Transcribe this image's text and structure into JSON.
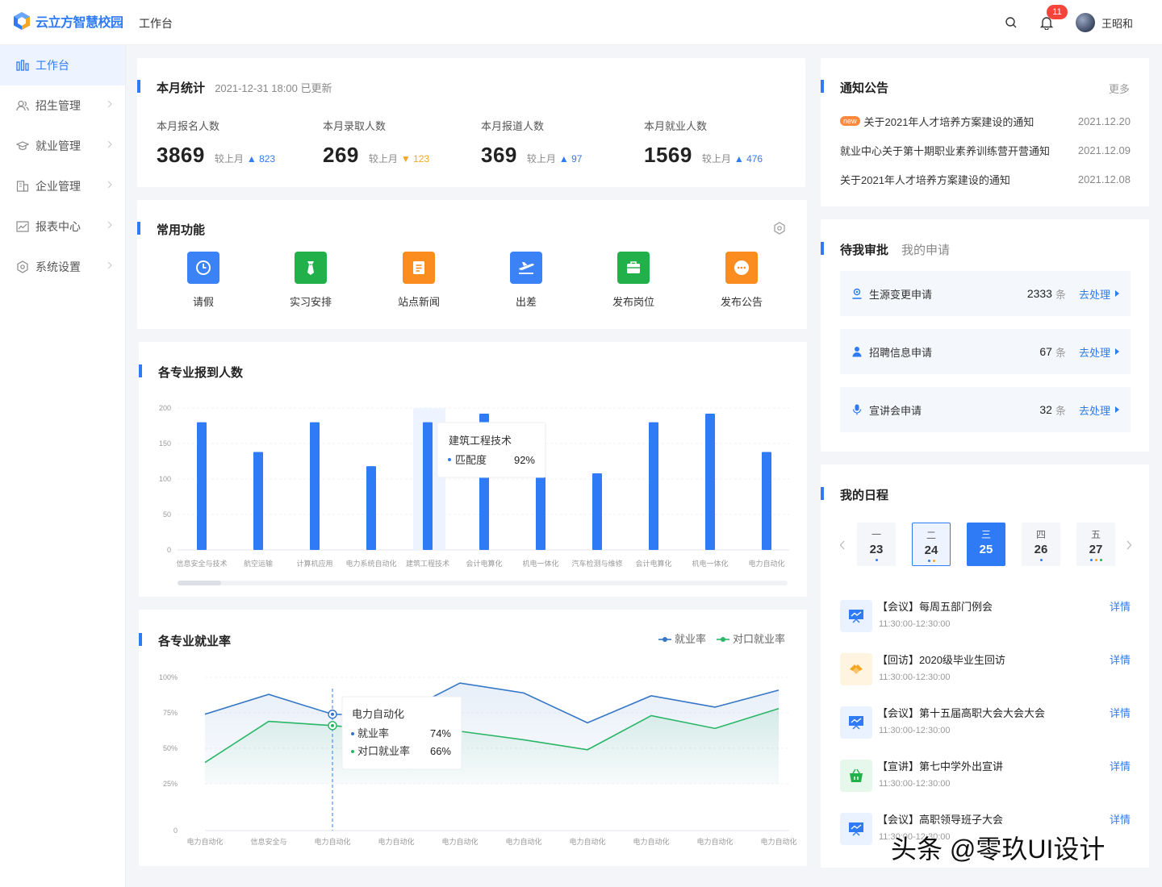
{
  "app": {
    "logo_text": "云立方智慧校园",
    "page_name": "工作台"
  },
  "header": {
    "notification_count": "11",
    "username": "王昭和"
  },
  "sidebar": {
    "items": [
      {
        "label": "工作台",
        "icon": "dashboard-icon",
        "active": true
      },
      {
        "label": "招生管理",
        "icon": "users-icon"
      },
      {
        "label": "就业管理",
        "icon": "graduation-cap-icon"
      },
      {
        "label": "企业管理",
        "icon": "building-icon"
      },
      {
        "label": "报表中心",
        "icon": "report-chart-icon"
      },
      {
        "label": "系统设置",
        "icon": "settings-hex-icon"
      }
    ]
  },
  "stats": {
    "title": "本月统计",
    "updated": "2021-12-31 18:00 已更新",
    "compare_label": "较上月",
    "items": [
      {
        "label": "本月报名人数",
        "value": "3869",
        "delta": "823",
        "direction": "up"
      },
      {
        "label": "本月录取人数",
        "value": "269",
        "delta": "123",
        "direction": "down"
      },
      {
        "label": "本月报道人数",
        "value": "369",
        "delta": "97",
        "direction": "up"
      },
      {
        "label": "本月就业人数",
        "value": "1569",
        "delta": "476",
        "direction": "up"
      }
    ],
    "colors": {
      "up": "#2f7bf5",
      "down": "#f5a623"
    }
  },
  "functions": {
    "title": "常用功能",
    "items": [
      {
        "label": "请假",
        "icon": "clock-icon",
        "color": "#3b82f6"
      },
      {
        "label": "实习安排",
        "icon": "tie-icon",
        "color": "#22b04b"
      },
      {
        "label": "站点新闻",
        "icon": "news-icon",
        "color": "#fb8c1f"
      },
      {
        "label": "出差",
        "icon": "airplane-icon",
        "color": "#3b82f6"
      },
      {
        "label": "发布岗位",
        "icon": "briefcase-icon",
        "color": "#22b04b"
      },
      {
        "label": "发布公告",
        "icon": "chat-bubble-icon",
        "color": "#fb8c1f"
      }
    ]
  },
  "notices": {
    "title": "通知公告",
    "more": "更多",
    "new_tag": "new",
    "items": [
      {
        "text": "关于2021年人才培养方案建设的通知",
        "date": "2021.12.20",
        "is_new": true
      },
      {
        "text": "就业中心关于第十期职业素养训练营开营通知",
        "date": "2021.12.09"
      },
      {
        "text": "关于2021年人才培养方案建设的通知",
        "date": "2021.12.08"
      }
    ]
  },
  "approvals": {
    "tabs": [
      "待我审批",
      "我的申请"
    ],
    "unit": "条",
    "action": "去处理",
    "items": [
      {
        "name": "生源变更申请",
        "count": "2333",
        "icon": "user-badge-icon"
      },
      {
        "name": "招聘信息申请",
        "count": "67",
        "icon": "person-icon"
      },
      {
        "name": "宣讲会申请",
        "count": "32",
        "icon": "microphone-icon"
      }
    ]
  },
  "schedule": {
    "title": "我的日程",
    "days": [
      {
        "week": "一",
        "date": "23",
        "dots": [
          "#2f7bf5"
        ]
      },
      {
        "week": "二",
        "date": "24",
        "dots": [
          "#2f7bf5",
          "#f5a623"
        ],
        "selected": true
      },
      {
        "week": "三",
        "date": "25",
        "dots": [],
        "today": true
      },
      {
        "week": "四",
        "date": "26",
        "dots": [
          "#2f7bf5"
        ]
      },
      {
        "week": "五",
        "date": "27",
        "dots": [
          "#2f7bf5",
          "#f5a623",
          "#22b04b"
        ]
      }
    ],
    "detail": "详情",
    "events": [
      {
        "title": "【会议】每周五部门例会",
        "time": "11:30:00-12:30:00",
        "icon": "presentation-icon",
        "color": "#2f7bf5",
        "bg": "#eaf2ff"
      },
      {
        "title": "【回访】2020级毕业生回访",
        "time": "11:30:00-12:30:00",
        "icon": "handshake-icon",
        "color": "#f5a623",
        "bg": "#fff4e0"
      },
      {
        "title": "【会议】第十五届高职大会大会大会",
        "time": "11:30:00-12:30:00",
        "icon": "presentation-icon",
        "color": "#2f7bf5",
        "bg": "#eaf2ff"
      },
      {
        "title": "【宣讲】第七中学外出宣讲",
        "time": "11:30:00-12:30:00",
        "icon": "basket-icon",
        "color": "#22b04b",
        "bg": "#e6f7ec"
      },
      {
        "title": "【会议】高职领导班子大会",
        "time": "11:30:00-12:30:00",
        "icon": "presentation-icon",
        "color": "#2f7bf5",
        "bg": "#eaf2ff"
      }
    ]
  },
  "watermark": "头条 @零玖UI设计",
  "chart_data": [
    {
      "type": "bar",
      "title": "各专业报到人数",
      "categories": [
        "信息安全与技术",
        "航空运输",
        "计算机应用",
        "电力系统自动化",
        "建筑工程技术",
        "会计电算化",
        "机电一体化",
        "汽车检测与维修",
        "会计电算化",
        "机电一体化",
        "电力自动化"
      ],
      "values": [
        180,
        138,
        180,
        118,
        180,
        192,
        120,
        108,
        180,
        192,
        138
      ],
      "ylim": [
        0,
        200
      ],
      "yticks": [
        0,
        50,
        100,
        150,
        200
      ],
      "highlight_index": 4,
      "color": "#2f7bf5",
      "tooltip": {
        "title": "建筑工程技术",
        "label": "匹配度",
        "value": "92%"
      }
    },
    {
      "type": "line",
      "title": "各专业就业率",
      "categories": [
        "电力自动化",
        "信息安全与",
        "电力自动化",
        "电力自动化",
        "电力自动化",
        "电力自动化",
        "电力自动化",
        "电力自动化",
        "电力自动化",
        "电力自动化"
      ],
      "series": [
        {
          "name": "就业率",
          "values": [
            74,
            88,
            74,
            73,
            96,
            89,
            68,
            87,
            79,
            91
          ],
          "color": "#3576c7"
        },
        {
          "name": "对口就业率",
          "values": [
            40,
            69,
            66,
            62,
            62,
            56,
            49,
            73,
            64,
            78
          ],
          "color": "#2ab567"
        }
      ],
      "ylim": [
        0,
        100
      ],
      "yticks": [
        "0",
        "25%",
        "50%",
        "75%",
        "100%"
      ],
      "highlight_index": 2,
      "tooltip": {
        "title": "电力自动化",
        "rows": [
          {
            "label": "就业率",
            "value": "74%"
          },
          {
            "label": "对口就业率",
            "value": "66%"
          }
        ]
      }
    }
  ]
}
